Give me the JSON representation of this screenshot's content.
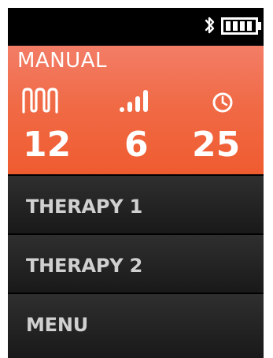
{
  "status_bar": {
    "icons": [
      "bluetooth-icon",
      "battery-icon"
    ]
  },
  "manual_panel": {
    "title": "MANUAL",
    "metrics": [
      {
        "icon": "pulse-wave-icon",
        "value": "12"
      },
      {
        "icon": "signal-bars-icon",
        "value": "6"
      },
      {
        "icon": "timer-icon",
        "value": "25"
      }
    ],
    "colors": {
      "gradient_top": "#f37d67",
      "gradient_bottom": "#ef5a2e"
    }
  },
  "menu": {
    "items": [
      {
        "label": "THERAPY 1"
      },
      {
        "label": "THERAPY 2"
      },
      {
        "label": "MENU"
      }
    ]
  }
}
